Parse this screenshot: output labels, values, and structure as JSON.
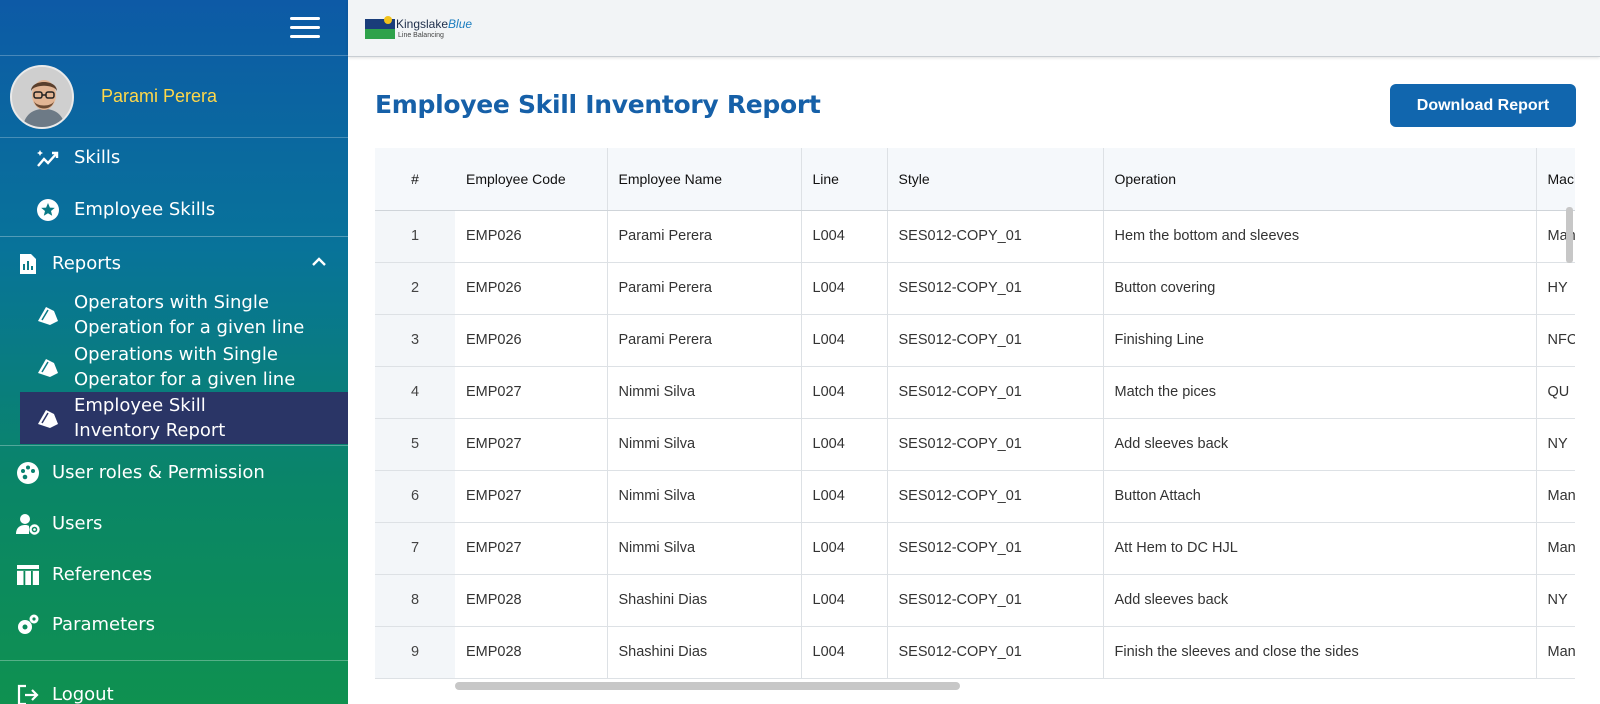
{
  "sidebar": {
    "user_name": "Parami Perera",
    "items": [
      {
        "label": "Skills",
        "icon": "trending-chart-icon"
      },
      {
        "label": "Employee Skills",
        "icon": "star-badge-icon"
      },
      {
        "label": "Reports",
        "icon": "report-document-icon"
      },
      {
        "label": "Operators with Single Operation for a given line",
        "line1": "Operators with Single",
        "line2": "Operation for a given line",
        "icon": "tag-icon"
      },
      {
        "label": "Operations with Single Operator for a given line",
        "line1": "Operations with Single",
        "line2": "Operator for a given line",
        "icon": "tag-icon"
      },
      {
        "label": "Employee Skill Inventory Report",
        "line1": "Employee Skill",
        "line2": "Inventory Report",
        "icon": "tag-icon",
        "active": true
      },
      {
        "label": "User roles & Permission",
        "icon": "palette-icon"
      },
      {
        "label": "Users",
        "icon": "user-gear-icon"
      },
      {
        "label": "References",
        "icon": "table-icon"
      },
      {
        "label": "Parameters",
        "icon": "gears-icon"
      },
      {
        "label": "Logout",
        "icon": "logout-icon"
      }
    ]
  },
  "header": {
    "logo_brand": "Kingslake",
    "logo_accent": "Blue",
    "logo_sub": "Line Balancing"
  },
  "main": {
    "title": "Employee Skill Inventory Report",
    "download_label": "Download Report",
    "columns": [
      "#",
      "Employee Code",
      "Employee Name",
      "Line",
      "Style",
      "Operation",
      "Machine"
    ],
    "rows": [
      [
        "1",
        "EMP026",
        "Parami Perera",
        "L004",
        "SES012-COPY_01",
        "Hem the bottom and sleeves",
        "Manual"
      ],
      [
        "2",
        "EMP026",
        "Parami Perera",
        "L004",
        "SES012-COPY_01",
        "Button covering",
        "HY"
      ],
      [
        "3",
        "EMP026",
        "Parami Perera",
        "L004",
        "SES012-COPY_01",
        "Finishing Line",
        "NFC"
      ],
      [
        "4",
        "EMP027",
        "Nimmi Silva",
        "L004",
        "SES012-COPY_01",
        "Match the pices",
        "QU"
      ],
      [
        "5",
        "EMP027",
        "Nimmi Silva",
        "L004",
        "SES012-COPY_01",
        "Add sleeves back",
        "NY"
      ],
      [
        "6",
        "EMP027",
        "Nimmi Silva",
        "L004",
        "SES012-COPY_01",
        "Button Attach",
        "Manual"
      ],
      [
        "7",
        "EMP027",
        "Nimmi Silva",
        "L004",
        "SES012-COPY_01",
        "Att Hem to DC HJL",
        "Manual"
      ],
      [
        "8",
        "EMP028",
        "Shashini Dias",
        "L004",
        "SES012-COPY_01",
        "Add sleeves back",
        "NY"
      ],
      [
        "9",
        "EMP028",
        "Shashini Dias",
        "L004",
        "SES012-COPY_01",
        "Finish the sleeves and close the sides",
        "Manual"
      ]
    ]
  },
  "colors": {
    "brand_blue": "#1166ae",
    "title_blue": "#1660a8",
    "user_name": "#ffd84a",
    "active_nav": "#2a3566"
  }
}
